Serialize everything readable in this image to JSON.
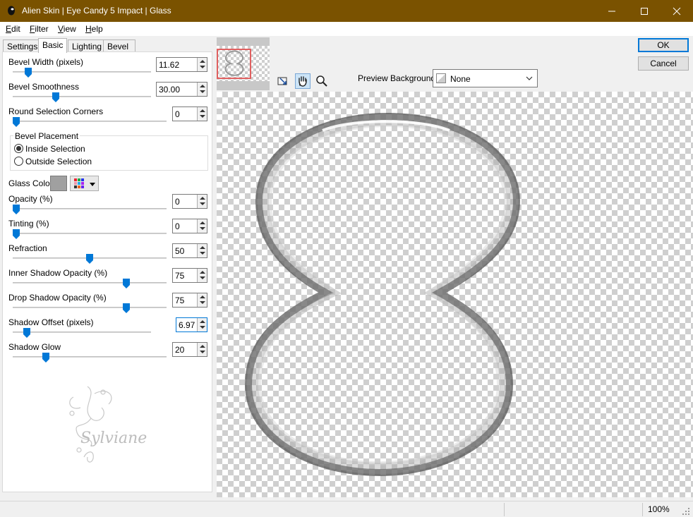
{
  "window": {
    "title": "Alien Skin | Eye Candy 5 Impact | Glass",
    "minimize_icon": "minimize-icon",
    "maximize_icon": "maximize-icon",
    "close_icon": "close-icon"
  },
  "menu": [
    {
      "label": "Edit",
      "key": "E",
      "rest": "dit"
    },
    {
      "label": "Filter",
      "key": "F",
      "rest": "ilter"
    },
    {
      "label": "View",
      "key": "V",
      "rest": "iew"
    },
    {
      "label": "Help",
      "key": "H",
      "rest": "elp"
    }
  ],
  "tabs": [
    "Settings",
    "Basic",
    "Lighting",
    "Bevel Profile"
  ],
  "active_tab": "Basic",
  "controls": {
    "bevel_width": {
      "label": "Bevel Width (pixels)",
      "value": "11.62",
      "level": 0.09
    },
    "bevel_smoothness": {
      "label": "Bevel Smoothness",
      "value": "30.00",
      "level": 0.3
    },
    "round_corners": {
      "label": "Round Selection Corners",
      "value": "0",
      "level": 0.0
    },
    "bevel_placement": {
      "label": "Bevel Placement",
      "options": [
        "Inside Selection",
        "Outside Selection"
      ],
      "selected": "Inside Selection"
    },
    "glass_color": {
      "label": "Glass Color",
      "color": "#a0a0a0"
    },
    "opacity": {
      "label": "Opacity (%)",
      "value": "0",
      "level": 0.0
    },
    "tinting": {
      "label": "Tinting (%)",
      "value": "0",
      "level": 0.0
    },
    "refraction": {
      "label": "Refraction",
      "value": "50",
      "level": 0.5
    },
    "inner_shadow": {
      "label": "Inner Shadow Opacity (%)",
      "value": "75",
      "level": 0.75
    },
    "drop_shadow": {
      "label": "Drop Shadow Opacity (%)",
      "value": "75",
      "level": 0.75
    },
    "shadow_offset": {
      "label": "Shadow Offset (pixels)",
      "value": "6.97",
      "level": 0.08
    },
    "shadow_glow": {
      "label": "Shadow Glow",
      "value": "20",
      "level": 0.2
    }
  },
  "watermark_text": "Sylviane",
  "preview": {
    "background_label": "Preview Background:",
    "background_value": "None",
    "tools": [
      "navigate-icon",
      "hand-icon",
      "zoom-icon"
    ]
  },
  "buttons": {
    "ok": "OK",
    "cancel": "Cancel"
  },
  "status": {
    "zoom": "100%"
  },
  "colors": {
    "titlebar": "#7a5200",
    "accent": "#0078d7"
  }
}
